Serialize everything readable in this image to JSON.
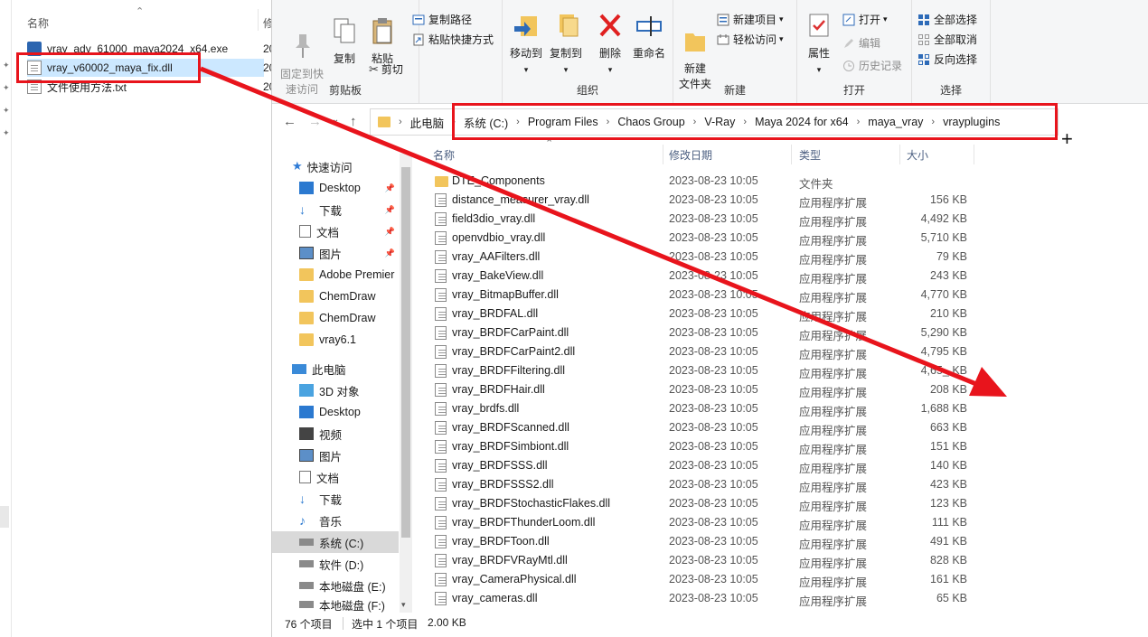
{
  "bg_explorer": {
    "col_name": "名称",
    "col_mod_partial": "修",
    "files": [
      {
        "name": "vray_adv_61000_maya2024_x64.exe",
        "date_partial": "20",
        "icon": "exe-icon",
        "selected": false
      },
      {
        "name": "vray_v60002_maya_fix.dll",
        "date_partial": "20",
        "icon": "dll-file-icon",
        "selected": true
      },
      {
        "name": "文件使用方法.txt",
        "date_partial": "20",
        "icon": "text-file-icon",
        "selected": false
      }
    ]
  },
  "ribbon": {
    "pin_quick_access": "固定到快\n速访问",
    "copy": "复制",
    "paste": "粘贴",
    "copy_path": "复制路径",
    "paste_shortcut": "粘贴快捷方式",
    "cut": "剪切",
    "clipboard_group": "剪贴板",
    "move_to": "移动到",
    "copy_to": "复制到",
    "delete": "删除",
    "rename": "重命名",
    "organize_group": "组织",
    "new_folder": "新建\n文件夹",
    "new_item": "新建项目",
    "easy_access": "轻松访问",
    "new_group": "新建",
    "properties": "属性",
    "open": "打开",
    "edit": "编辑",
    "history": "历史记录",
    "open_group": "打开",
    "select_all": "全部选择",
    "select_none": "全部取消",
    "invert_selection": "反向选择",
    "select_group": "选择"
  },
  "address": {
    "root": "此电脑",
    "crumbs": [
      "系统 (C:)",
      "Program Files",
      "Chaos Group",
      "V-Ray",
      "Maya 2024 for x64",
      "maya_vray",
      "vrayplugins"
    ]
  },
  "nav": {
    "quick_access": "快速访问",
    "items": [
      {
        "label": "Desktop",
        "icon": "desktop-icon",
        "pinned": true
      },
      {
        "label": "下载",
        "icon": "download-icon",
        "pinned": true
      },
      {
        "label": "文档",
        "icon": "documents-icon",
        "pinned": true
      },
      {
        "label": "图片",
        "icon": "pictures-icon",
        "pinned": true
      },
      {
        "label": "Adobe Premier",
        "icon": "folder-icon",
        "pinned": false
      },
      {
        "label": "ChemDraw",
        "icon": "folder-icon",
        "pinned": false
      },
      {
        "label": "ChemDraw",
        "icon": "folder-icon",
        "pinned": false
      },
      {
        "label": "vray6.1",
        "icon": "folder-icon",
        "pinned": false
      }
    ],
    "this_pc": "此电脑",
    "pc_items": [
      {
        "label": "3D 对象",
        "icon": "3d-objects-icon",
        "selected": false
      },
      {
        "label": "Desktop",
        "icon": "desktop-icon",
        "selected": false
      },
      {
        "label": "视频",
        "icon": "videos-icon",
        "selected": false
      },
      {
        "label": "图片",
        "icon": "pictures-icon",
        "selected": false
      },
      {
        "label": "文档",
        "icon": "documents-icon",
        "selected": false
      },
      {
        "label": "下载",
        "icon": "download-icon",
        "selected": false
      },
      {
        "label": "音乐",
        "icon": "music-icon",
        "selected": false
      },
      {
        "label": "系统 (C:)",
        "icon": "drive-icon",
        "selected": true
      },
      {
        "label": "软件 (D:)",
        "icon": "drive-icon",
        "selected": false
      },
      {
        "label": "本地磁盘 (E:)",
        "icon": "drive-icon",
        "selected": false
      },
      {
        "label": "本地磁盘 (F:)",
        "icon": "drive-icon",
        "selected": false
      }
    ]
  },
  "list": {
    "headers": {
      "name": "名称",
      "date": "修改日期",
      "type": "类型",
      "size": "大小"
    },
    "rows": [
      {
        "name": "DTE_Components",
        "date": "2023-08-23 10:05",
        "type": "文件夹",
        "size": "",
        "kind": "folder"
      },
      {
        "name": "distance_measurer_vray.dll",
        "date": "2023-08-23 10:05",
        "type": "应用程序扩展",
        "size": "156 KB",
        "kind": "dll"
      },
      {
        "name": "field3dio_vray.dll",
        "date": "2023-08-23 10:05",
        "type": "应用程序扩展",
        "size": "4,492 KB",
        "kind": "dll"
      },
      {
        "name": "openvdbio_vray.dll",
        "date": "2023-08-23 10:05",
        "type": "应用程序扩展",
        "size": "5,710 KB",
        "kind": "dll"
      },
      {
        "name": "vray_AAFilters.dll",
        "date": "2023-08-23 10:05",
        "type": "应用程序扩展",
        "size": "79 KB",
        "kind": "dll"
      },
      {
        "name": "vray_BakeView.dll",
        "date": "2023-08-23 10:05",
        "type": "应用程序扩展",
        "size": "243 KB",
        "kind": "dll"
      },
      {
        "name": "vray_BitmapBuffer.dll",
        "date": "2023-08-23 10:05",
        "type": "应用程序扩展",
        "size": "4,770 KB",
        "kind": "dll"
      },
      {
        "name": "vray_BRDFAL.dll",
        "date": "2023-08-23 10:05",
        "type": "应用程序扩展",
        "size": "210 KB",
        "kind": "dll"
      },
      {
        "name": "vray_BRDFCarPaint.dll",
        "date": "2023-08-23 10:05",
        "type": "应用程序扩展",
        "size": "5,290 KB",
        "kind": "dll"
      },
      {
        "name": "vray_BRDFCarPaint2.dll",
        "date": "2023-08-23 10:05",
        "type": "应用程序扩展",
        "size": "4,795 KB",
        "kind": "dll"
      },
      {
        "name": "vray_BRDFFiltering.dll",
        "date": "2023-08-23 10:05",
        "type": "应用程序扩展",
        "size": "4,65_ KB",
        "kind": "dll"
      },
      {
        "name": "vray_BRDFHair.dll",
        "date": "2023-08-23 10:05",
        "type": "应用程序扩展",
        "size": "208 KB",
        "kind": "dll"
      },
      {
        "name": "vray_brdfs.dll",
        "date": "2023-08-23 10:05",
        "type": "应用程序扩展",
        "size": "1,688 KB",
        "kind": "dll"
      },
      {
        "name": "vray_BRDFScanned.dll",
        "date": "2023-08-23 10:05",
        "type": "应用程序扩展",
        "size": "663 KB",
        "kind": "dll"
      },
      {
        "name": "vray_BRDFSimbiont.dll",
        "date": "2023-08-23 10:05",
        "type": "应用程序扩展",
        "size": "151 KB",
        "kind": "dll"
      },
      {
        "name": "vray_BRDFSSS.dll",
        "date": "2023-08-23 10:05",
        "type": "应用程序扩展",
        "size": "140 KB",
        "kind": "dll"
      },
      {
        "name": "vray_BRDFSSS2.dll",
        "date": "2023-08-23 10:05",
        "type": "应用程序扩展",
        "size": "423 KB",
        "kind": "dll"
      },
      {
        "name": "vray_BRDFStochasticFlakes.dll",
        "date": "2023-08-23 10:05",
        "type": "应用程序扩展",
        "size": "123 KB",
        "kind": "dll"
      },
      {
        "name": "vray_BRDFThunderLoom.dll",
        "date": "2023-08-23 10:05",
        "type": "应用程序扩展",
        "size": "111 KB",
        "kind": "dll"
      },
      {
        "name": "vray_BRDFToon.dll",
        "date": "2023-08-23 10:05",
        "type": "应用程序扩展",
        "size": "491 KB",
        "kind": "dll"
      },
      {
        "name": "vray_BRDFVRayMtl.dll",
        "date": "2023-08-23 10:05",
        "type": "应用程序扩展",
        "size": "828 KB",
        "kind": "dll"
      },
      {
        "name": "vray_CameraPhysical.dll",
        "date": "2023-08-23 10:05",
        "type": "应用程序扩展",
        "size": "161 KB",
        "kind": "dll"
      },
      {
        "name": "vray_cameras.dll",
        "date": "2023-08-23 10:05",
        "type": "应用程序扩展",
        "size": "65 KB",
        "kind": "dll"
      }
    ]
  },
  "status": {
    "count": "76 个项目",
    "selected": "选中 1 个项目",
    "size": "2.00 KB"
  },
  "colors": {
    "annotation_red": "#e8141c",
    "selection_blue": "#cce8ff",
    "folder_yellow": "#f2c55c"
  }
}
